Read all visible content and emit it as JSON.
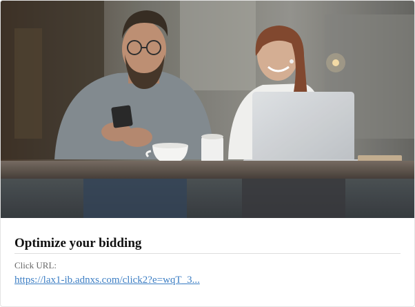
{
  "ad": {
    "image_alt": "Man using phone and woman with laptop at a cafe table",
    "title": "Optimize your bidding",
    "click_url_label": "Click URL:",
    "click_url": "https://lax1-ib.adnxs.com/click2?e=wqT_3..."
  },
  "colors": {
    "link": "#3c7ec4",
    "title": "#111111",
    "label": "#666666",
    "border": "#e3e3e3"
  }
}
